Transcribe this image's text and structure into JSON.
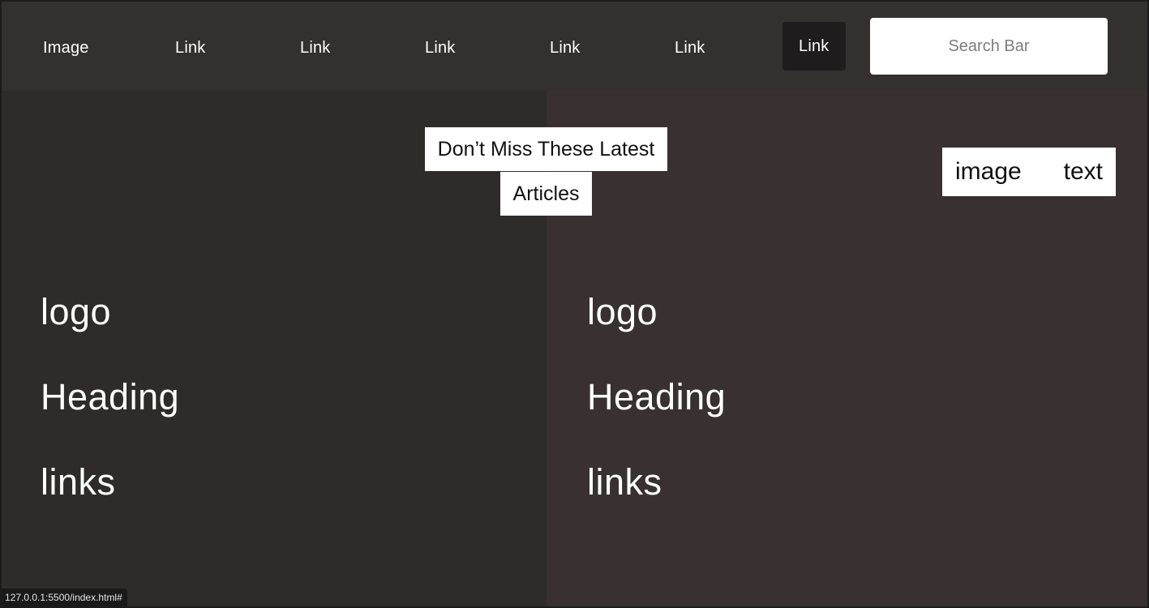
{
  "nav": {
    "items": [
      "Image",
      "Link",
      "Link",
      "Link",
      "Link",
      "Link",
      "Link"
    ],
    "active_index": 6
  },
  "search": {
    "placeholder": "Search Bar"
  },
  "hero": {
    "headline": "Don’t Miss These Latest Articles",
    "image_text": {
      "image": "image",
      "text": "text"
    }
  },
  "columns": [
    {
      "logo": "logo",
      "heading": "Heading",
      "links": "links"
    },
    {
      "logo": "logo",
      "heading": "Heading",
      "links": "links"
    }
  ],
  "status_bar": {
    "url": "127.0.0.1:5500/index.html#"
  },
  "colors": {
    "background_left": "#2f2b2b",
    "background_right": "#383031",
    "topbar": "#353030",
    "active_link": "#1e1c1c",
    "text": "#ffffff"
  }
}
